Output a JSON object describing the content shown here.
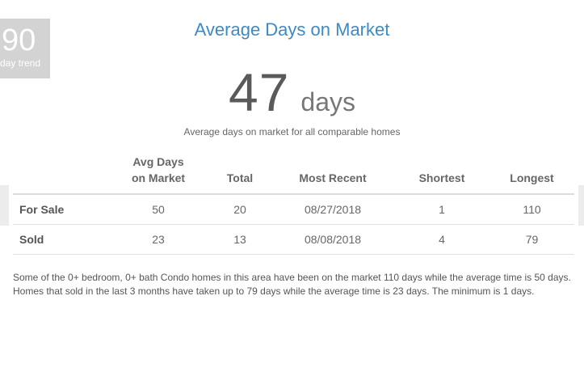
{
  "trend": {
    "value": "90",
    "label": "day trend"
  },
  "title": "Average Days on Market",
  "stat": {
    "value": "47",
    "unit": "days"
  },
  "subtitle": "Average days on market for all comparable homes",
  "table": {
    "headers": [
      "",
      "Avg Days\non Market",
      "Total",
      "Most Recent",
      "Shortest",
      "Longest"
    ],
    "rows": [
      {
        "label": "For Sale",
        "avg": "50",
        "total": "20",
        "recent": "08/27/2018",
        "shortest": "1",
        "longest": "110"
      },
      {
        "label": "Sold",
        "avg": "23",
        "total": "13",
        "recent": "08/08/2018",
        "shortest": "4",
        "longest": "79"
      }
    ]
  },
  "summary": "Some of the 0+ bedroom, 0+ bath Condo homes in this area have been on the market 110 days while the average time is 50 days. Homes that sold in the last 3 months have taken up to 79 days while the average time is 23 days. The minimum is 1 days."
}
